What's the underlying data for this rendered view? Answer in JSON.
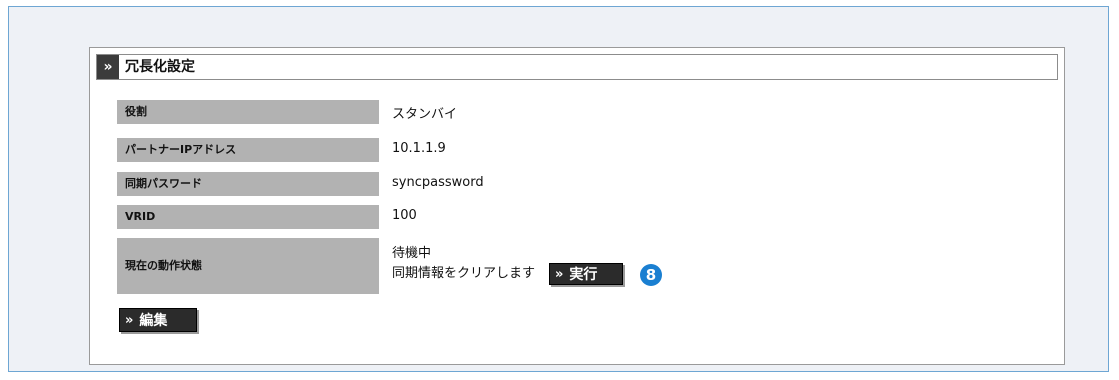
{
  "panel": {
    "title_chevron": "»",
    "title": "冗長化設定"
  },
  "rows": [
    {
      "label": "役割",
      "value": "スタンバイ"
    },
    {
      "label": "パートナーIPアドレス",
      "value": "10.1.1.9"
    },
    {
      "label": "同期パスワード",
      "value": "syncpassword"
    },
    {
      "label": "VRID",
      "value": "100"
    },
    {
      "label": "現在の動作状態",
      "value_line1": "待機中",
      "value_line2": "同期情報をクリアします"
    }
  ],
  "execute_button": {
    "chevron": "»",
    "label": "実行"
  },
  "badge": "8",
  "edit_button": {
    "chevron": "»",
    "label": "編集"
  },
  "colors": {
    "accent_badge": "#1a7fd1",
    "label_bg": "#b2b2b2",
    "button_bg": "#2b2b2b",
    "frame_bg": "#eef1f6"
  }
}
